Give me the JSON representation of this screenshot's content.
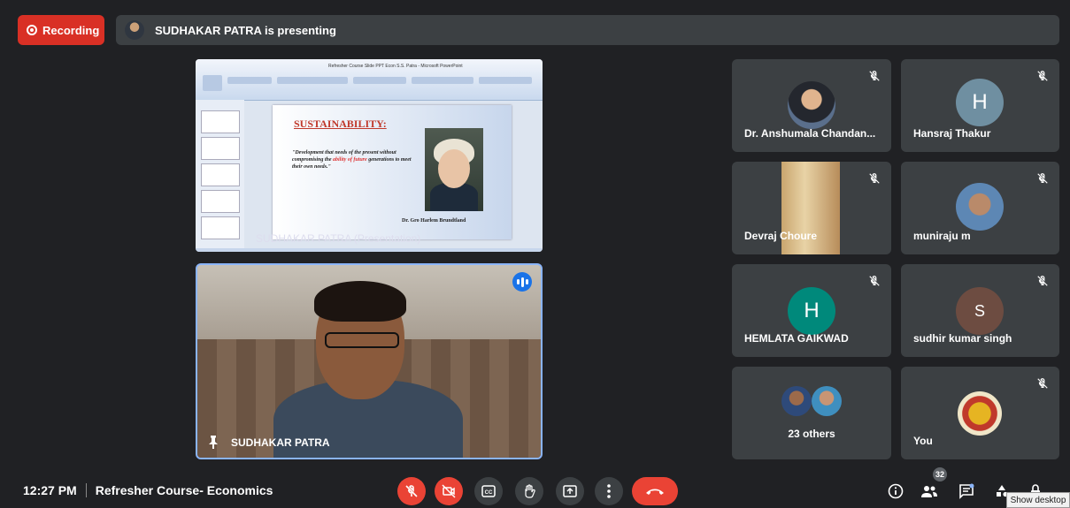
{
  "recording": {
    "label": "Recording"
  },
  "presenting_banner": {
    "text": "SUDHAKAR PATRA is presenting"
  },
  "presentation": {
    "slide_title": "SUSTAINABILITY:",
    "quote_part1": "\"Development that needs of the present without compromising the ",
    "quote_red": "ability of future",
    "quote_part2": " generations to meet their own needs.\"",
    "caption": "Dr. Gro Harlem Brundtland",
    "tile_label": "SUDHAKAR PATRA (Presentation)",
    "app_title": "Refresher Course Slide PPT Econ S.S. Patra - Microsoft PowerPoint"
  },
  "speaker": {
    "name": "SUDHAKAR PATRA"
  },
  "participants": [
    {
      "name": "Dr. Anshumala Chandan..."
    },
    {
      "name": "Hansraj Thakur",
      "initial": "H",
      "color": "#6f8fa1"
    },
    {
      "name": "Devraj Choure"
    },
    {
      "name": "muniraju m"
    },
    {
      "name": "HEMLATA GAIKWAD",
      "initial": "H",
      "color": "#00897b"
    },
    {
      "name": "sudhir kumar singh",
      "initial": "S",
      "color": "#6d4c41"
    },
    {
      "name": "23 others"
    },
    {
      "name": "You"
    }
  ],
  "meeting": {
    "time": "12:27 PM",
    "title": "Refresher Course- Economics"
  },
  "people_count": "32",
  "tooltip": "Show desktop"
}
